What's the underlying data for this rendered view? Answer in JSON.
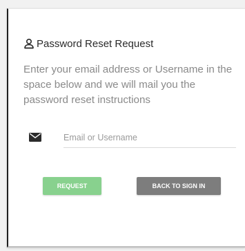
{
  "panel": {
    "title": "Password Reset Request",
    "title_icon": "user-icon",
    "description": "Enter your email address or Username in the space below and we will mail you the password reset instructions"
  },
  "form": {
    "field_icon": "envelope-icon",
    "email_value": "",
    "email_placeholder": "Email or Username"
  },
  "actions": {
    "request_label": "REQUEST",
    "back_label": "BACK TO SIGN IN"
  },
  "colors": {
    "request_button": "#88d18e",
    "back_button": "#7d7d7d",
    "description_text": "#8a8a8a"
  }
}
